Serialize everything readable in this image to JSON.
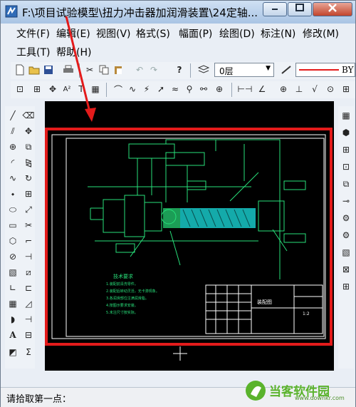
{
  "window": {
    "title": "F:\\项目试验模型\\扭力冲击器加润滑装置\\24定轴..."
  },
  "menu": {
    "items": [
      {
        "id": "file",
        "label": "文件(F)"
      },
      {
        "id": "edit",
        "label": "编辑(E)"
      },
      {
        "id": "view",
        "label": "视图(V)"
      },
      {
        "id": "format",
        "label": "格式(S)"
      },
      {
        "id": "sheet",
        "label": "幅面(P)"
      },
      {
        "id": "draw",
        "label": "绘图(D)"
      },
      {
        "id": "dimension",
        "label": "标注(N)"
      },
      {
        "id": "modify",
        "label": "修改(M)"
      },
      {
        "id": "tools",
        "label": "工具(T)"
      },
      {
        "id": "help",
        "label": "帮助(H)"
      }
    ]
  },
  "toolbar": {
    "layer_value": "0层",
    "linetype_value": "BY"
  },
  "drawing": {
    "tech_req_title": "技术要求",
    "tech_req_lines": [
      "1.装配前清洗零件。",
      "2.装配后转动灵活，无卡滞现象。",
      "3.各润滑部位注满润滑脂。",
      "4.按图示要求安装。",
      "5.未注尺寸按实际。"
    ],
    "title_block_name": "装配图",
    "scale": "1:2"
  },
  "status": {
    "prompt": "请拾取第一点："
  },
  "watermark": {
    "name": "当客软件园",
    "url": "www.downkr.com"
  },
  "colors": {
    "drawing_green": "#28e07a",
    "annotation_red": "#e31b1b",
    "accent_cyan": "#17c8c8"
  }
}
